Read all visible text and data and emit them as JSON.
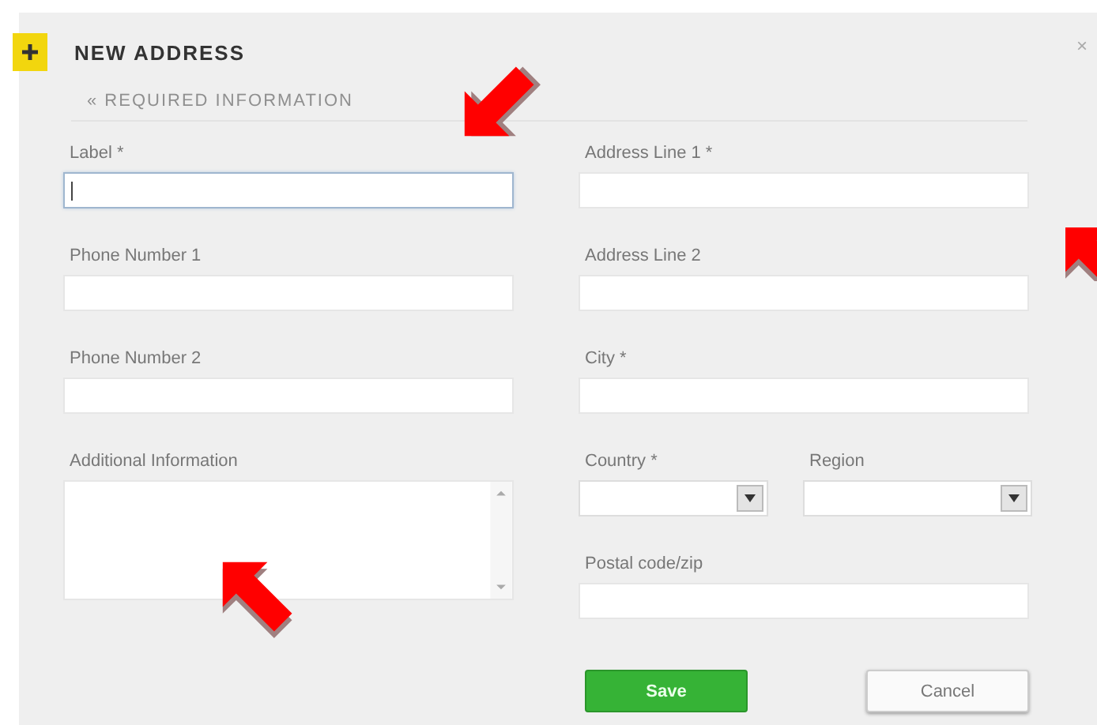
{
  "dialog": {
    "title": "NEW ADDRESS",
    "close": "×"
  },
  "section": "« REQUIRED INFORMATION",
  "left_fields": [
    {
      "kind": "text",
      "label": "Label *",
      "focused": true
    },
    {
      "kind": "text",
      "label": "Phone Number 1",
      "focused": false
    },
    {
      "kind": "text",
      "label": "Phone Number 2",
      "focused": false
    },
    {
      "kind": "textarea",
      "label": "Additional Information",
      "focused": false
    }
  ],
  "right_fields": [
    {
      "kind": "text",
      "label": "Address Line 1 *",
      "focused": false
    },
    {
      "kind": "text",
      "label": "Address Line 2",
      "focused": false
    },
    {
      "kind": "text",
      "label": "City *",
      "focused": false
    },
    {
      "kind": "selects",
      "items": [
        {
          "label": "Country *"
        },
        {
          "label": "Region"
        }
      ]
    },
    {
      "kind": "text",
      "label": "Postal code/zip",
      "focused": false
    }
  ],
  "buttons": [
    {
      "kind": "primary",
      "label": "Save"
    },
    {
      "kind": "secondary",
      "label": "Cancel"
    }
  ]
}
